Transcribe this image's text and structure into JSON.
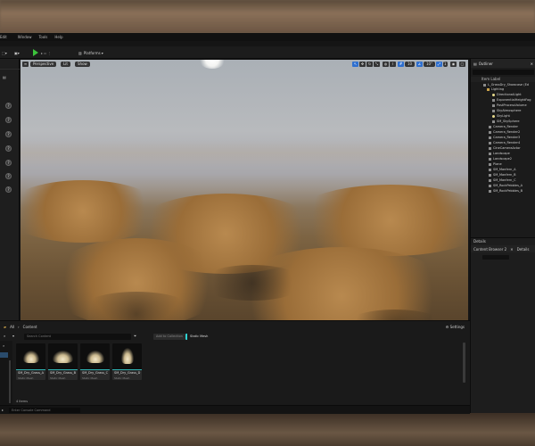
{
  "menu": [
    "Edit",
    "Window",
    "Tools",
    "Help"
  ],
  "toolbar": {
    "platforms_label": "Platforms"
  },
  "viewport": {
    "perspective_label": "Perspective",
    "lit_label": "Lit",
    "show_label": "Show",
    "grid_snap": "10",
    "rot_snap": "10°",
    "scale_snap": "0.25",
    "camera_speed": "1"
  },
  "outliner": {
    "title": "Outliner",
    "column_label": "Item Label",
    "rows": [
      {
        "label": "L_GrassDry_Showcase (Ed",
        "icon": "world-icon",
        "depth": 0
      },
      {
        "label": "Lighting",
        "icon": "folder-icon",
        "depth": 1
      },
      {
        "label": "DirectionalLight",
        "icon": "light-icon",
        "depth": 2
      },
      {
        "label": "ExponentialHeightFog",
        "icon": "actor-icon",
        "depth": 2
      },
      {
        "label": "PostProcessVolume",
        "icon": "actor-icon",
        "depth": 2
      },
      {
        "label": "SkyAtmosphere",
        "icon": "actor-icon",
        "depth": 2
      },
      {
        "label": "SkyLight",
        "icon": "light-icon",
        "depth": 2
      },
      {
        "label": "SM_SkySphere",
        "icon": "actor-icon",
        "depth": 2
      },
      {
        "label": "Camera_Render",
        "icon": "camera-icon",
        "depth": 1
      },
      {
        "label": "Camera_Render2",
        "icon": "camera-icon",
        "depth": 1
      },
      {
        "label": "Camera_Render3",
        "icon": "camera-icon",
        "depth": 1
      },
      {
        "label": "Camera_Render4",
        "icon": "camera-icon",
        "depth": 1
      },
      {
        "label": "CineCameraActor",
        "icon": "camera-icon",
        "depth": 1
      },
      {
        "label": "Landscape",
        "icon": "actor-icon",
        "depth": 1
      },
      {
        "label": "Landscape2",
        "icon": "actor-icon",
        "depth": 1
      },
      {
        "label": "Plane",
        "icon": "actor-icon",
        "depth": 1
      },
      {
        "label": "SM_Manfern_A",
        "icon": "actor-icon",
        "depth": 1
      },
      {
        "label": "SM_Manfern_B",
        "icon": "actor-icon",
        "depth": 1
      },
      {
        "label": "SM_Manfern_C",
        "icon": "actor-icon",
        "depth": 1
      },
      {
        "label": "SM_RockPebbles_A",
        "icon": "actor-icon",
        "depth": 1
      },
      {
        "label": "SM_RockPebbles_B",
        "icon": "actor-icon",
        "depth": 1
      }
    ]
  },
  "details": {
    "title": "Details",
    "tab_content_browser": "Content Browser 2",
    "tab_details": "Details"
  },
  "content_browser": {
    "breadcrumb_root": "All",
    "breadcrumb_folder": "Content",
    "settings_label": "Settings",
    "search_placeholder": "Search Content",
    "tag_static_mesh": "Static Mesh",
    "tag_other": "Add to Collection",
    "assets": [
      {
        "name": "SM_Dry_Grass_A",
        "type": "Static Mesh"
      },
      {
        "name": "SM_Dry_Grass_B",
        "type": "Static Mesh"
      },
      {
        "name": "SM_Dry_Grass_C",
        "type": "Static Mesh"
      },
      {
        "name": "SM_Dry_Grass_D",
        "type": "Static Mesh"
      }
    ],
    "item_count": "4 items"
  },
  "status": {
    "cmd_placeholder": "Enter Console Command"
  }
}
